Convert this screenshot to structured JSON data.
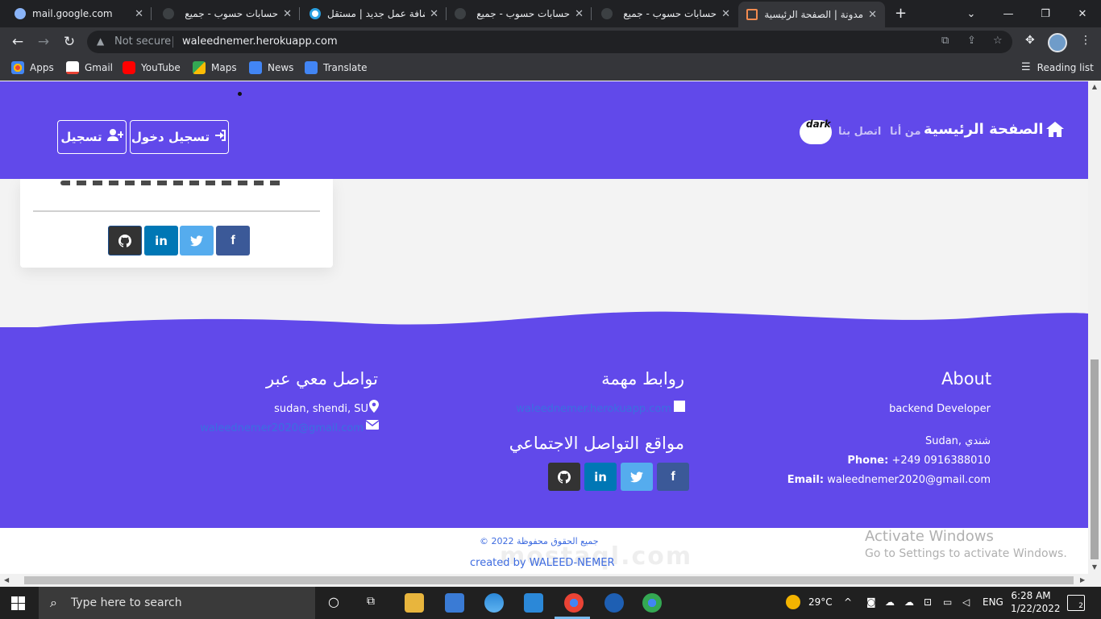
{
  "browser": {
    "tabs": [
      {
        "title": "mail.google.com",
        "fav_color": "#8ab4f8"
      },
      {
        "title": "حسابات حسوب - جميع",
        "fav_color": "#3c4043"
      },
      {
        "title": "إضافة عمل جديد | مستقل",
        "fav_color": "#2ba0e0"
      },
      {
        "title": "حسابات حسوب - جميع",
        "fav_color": "#3c4043"
      },
      {
        "title": "حسابات حسوب - جميع",
        "fav_color": "#3c4043"
      },
      {
        "title": "مدونة | الصفحة الرئيسية",
        "fav_color": "#f28b50"
      }
    ],
    "security_label": "Not secure",
    "url": "waleednemer.herokuapp.com",
    "bookmarks": [
      {
        "label": "Apps",
        "color": "#4285f4"
      },
      {
        "label": "Gmail",
        "color": "#ea4335"
      },
      {
        "label": "YouTube",
        "color": "#ff0000"
      },
      {
        "label": "Maps",
        "color": "#34a853"
      },
      {
        "label": "News",
        "color": "#4285f4"
      },
      {
        "label": "Translate",
        "color": "#4285f4"
      }
    ],
    "reading_list": "Reading list"
  },
  "site": {
    "nav": {
      "brand": "الصفحة الرئيسية",
      "about": "من أنا",
      "contact": "اتصل بنا",
      "toggle": "dark",
      "login": "تسجيل دخول",
      "register": "تسجيل"
    },
    "footer": {
      "about_title": "About",
      "about_role": "backend Developer",
      "location": "Sudan, شندي",
      "phone_label": "Phone:",
      "phone": "+249 0916388010",
      "email_label": "Email:",
      "email": "waleednemer2020@gmail.com",
      "links_title": "روابط مهمة",
      "links_site": "waleednemer.herokuapp.com",
      "social_title": "مواقع التواصل الاجتماعي",
      "contact_title": "تواصل معي عبر",
      "contact_address": "sudan, shendi, SU",
      "contact_email": "waleednemer2020@gmail.com"
    },
    "copyright": "© جميع الحقوق محفوظة 2022",
    "created_by": "created by WALEED-NEMER",
    "activate_title": "Activate Windows",
    "activate_sub": "Go to Settings to activate Windows.",
    "watermark": "mostaql.com"
  },
  "colors": {
    "brand": "#6149ea",
    "github": "#333333",
    "linkedin": "#0077b5",
    "twitter": "#55acee",
    "facebook": "#3b5998"
  },
  "taskbar": {
    "search_placeholder": "Type here to search",
    "weather": "29°C",
    "lang": "ENG",
    "time": "6:28 AM",
    "date": "1/22/2022",
    "notifications": "2"
  }
}
